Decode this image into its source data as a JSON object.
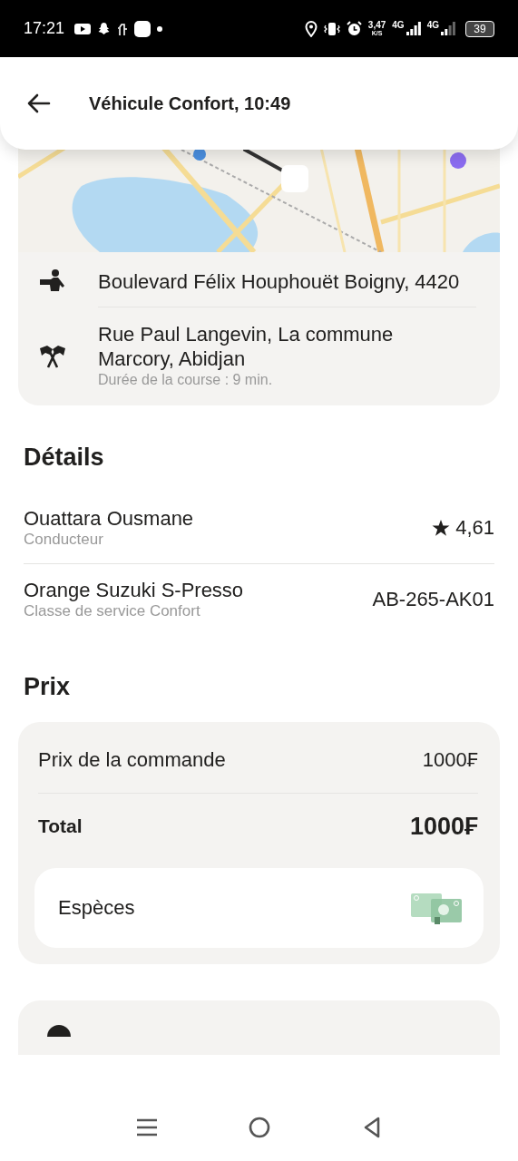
{
  "status_bar": {
    "time": "17:21",
    "speed": "3,47",
    "speed_unit": "K/S",
    "network_1": "4G",
    "network_2": "4G",
    "battery": "39"
  },
  "header": {
    "title": "Véhicule Confort, 10:49"
  },
  "route": {
    "points": [
      {
        "kind": "start",
        "address": "Boulevard Félix Houphouët Boigny, 4420"
      },
      {
        "kind": "finish",
        "address": "Rue Paul Langevin, La commune Marcory, Abidjan",
        "note": "Durée de la course : 9 min."
      }
    ]
  },
  "details": {
    "title": "Détails",
    "rows": [
      {
        "kind": "driver",
        "primary": "Ouattara Ousmane",
        "secondary": "Conducteur",
        "value": "4,61"
      },
      {
        "kind": "car",
        "primary": "Orange Suzuki S-Presso",
        "secondary": "Classe de service Confort",
        "value": "AB-265-AK01"
      }
    ]
  },
  "price": {
    "title": "Prix",
    "lines": [
      {
        "kind": "item",
        "label": "Prix de la commande",
        "amount": "1000₣"
      },
      {
        "kind": "total",
        "label": "Total",
        "amount": "1000₣"
      }
    ],
    "payment": {
      "method": "Espèces"
    }
  }
}
